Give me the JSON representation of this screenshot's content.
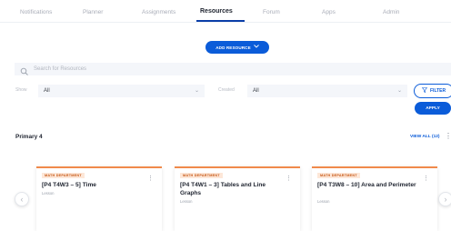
{
  "nav": {
    "tabs": [
      {
        "label": "Notifications",
        "active": false
      },
      {
        "label": "Planner",
        "active": false
      },
      {
        "label": "Assignments",
        "active": false
      },
      {
        "label": "Resources",
        "active": true
      },
      {
        "label": "Forum",
        "active": false
      },
      {
        "label": "Apps",
        "active": false
      },
      {
        "label": "Admin",
        "active": false
      }
    ]
  },
  "toolbar": {
    "add_resource_label": "ADD RESOURCE",
    "add_icon": "chevron-down-icon"
  },
  "search": {
    "placeholder": "Search for Resources"
  },
  "filters": {
    "first": {
      "label": "Show",
      "value": "All"
    },
    "second": {
      "label": "Created",
      "value": "All"
    },
    "filter_label": "FILTER",
    "apply_label": "APPLY"
  },
  "section": {
    "title": "Primary 4",
    "view_all_label": "VIEW ALL (12)"
  },
  "cards": [
    {
      "tag": "MATH DEPARTMENT",
      "title": "[P4 T4W3 – 5] Time",
      "type": "Lesson"
    },
    {
      "tag": "MATH DEPARTMENT",
      "title": "[P4 T4W1 – 3] Tables and Line Graphs",
      "type": "Lesson"
    },
    {
      "tag": "MATH DEPARTMENT",
      "title": "[P4 T3W8 – 10] Area and Perimeter",
      "type": "Lesson"
    }
  ],
  "colors": {
    "primary": "#0b5cd9",
    "card_accent": "#f08a4b",
    "tag_bg": "#fde7d8"
  }
}
